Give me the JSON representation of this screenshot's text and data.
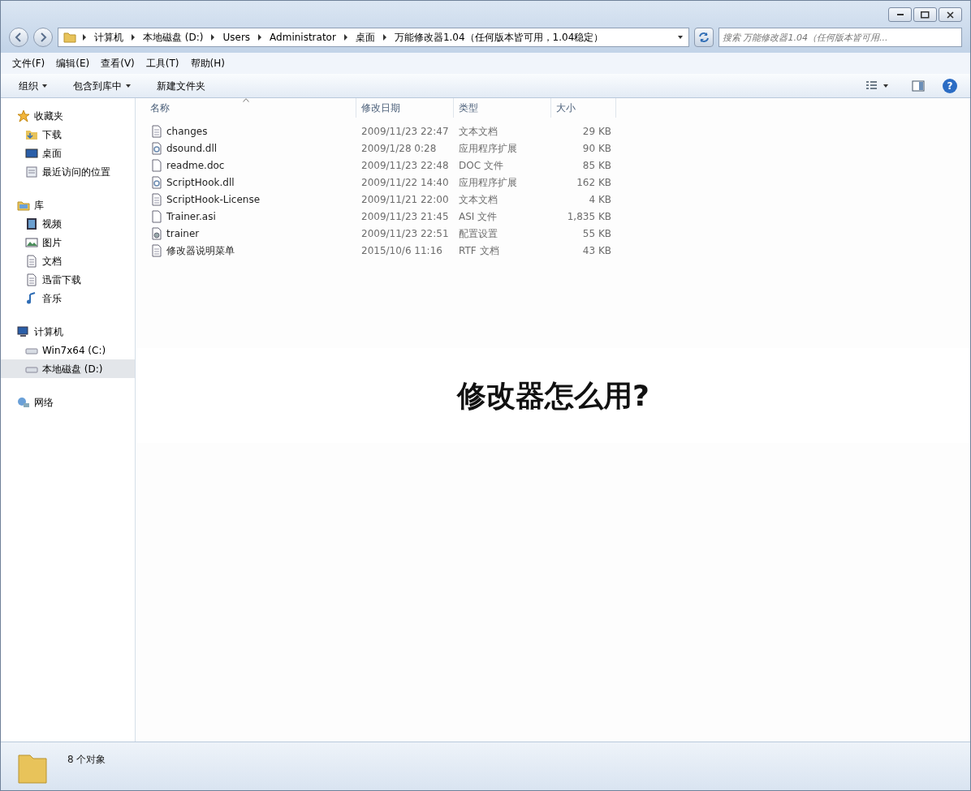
{
  "window": {
    "buttons": [
      {
        "kind": "minimize"
      },
      {
        "kind": "maximize"
      },
      {
        "kind": "close"
      }
    ]
  },
  "address_bar": {
    "crumbs": [
      "计算机",
      "本地磁盘 (D:)",
      "Users",
      "Administrator",
      "桌面",
      "万能修改器1.04（任何版本皆可用，1.04稳定）"
    ]
  },
  "search": {
    "placeholder": "搜索 万能修改器1.04（任何版本皆可用..."
  },
  "menu": [
    "文件(F)",
    "编辑(E)",
    "查看(V)",
    "工具(T)",
    "帮助(H)"
  ],
  "toolbar": [
    {
      "label": "组织",
      "dropdown": true
    },
    {
      "label": "包含到库中",
      "dropdown": true
    },
    {
      "label": "新建文件夹",
      "dropdown": false
    }
  ],
  "sidebar": {
    "groups": [
      {
        "label": "收藏夹",
        "kind": "star",
        "selected": false,
        "children": [
          {
            "label": "下载",
            "kind": "download",
            "selected": false
          },
          {
            "label": "桌面",
            "kind": "desktop",
            "selected": false
          },
          {
            "label": "最近访问的位置",
            "kind": "recent",
            "selected": false
          }
        ]
      },
      {
        "label": "库",
        "kind": "library",
        "selected": false,
        "children": [
          {
            "label": "视频",
            "kind": "video",
            "selected": false
          },
          {
            "label": "图片",
            "kind": "picture",
            "selected": false
          },
          {
            "label": "文档",
            "kind": "document",
            "selected": false
          },
          {
            "label": "迅雷下载",
            "kind": "document",
            "selected": false
          },
          {
            "label": "音乐",
            "kind": "music",
            "selected": false
          }
        ]
      },
      {
        "label": "计算机",
        "kind": "computer",
        "selected": false,
        "children": [
          {
            "label": "Win7x64 (C:)",
            "kind": "drive",
            "selected": false
          },
          {
            "label": "本地磁盘 (D:)",
            "kind": "drive",
            "selected": true
          }
        ]
      },
      {
        "label": "网络",
        "kind": "network",
        "selected": false
      }
    ]
  },
  "table": {
    "columns": [
      {
        "label": "名称",
        "sorted": true
      },
      {
        "label": "修改日期",
        "sorted": false
      },
      {
        "label": "类型",
        "sorted": false
      },
      {
        "label": "大小",
        "sorted": false
      }
    ],
    "rows": [
      {
        "kind": "text",
        "name": "changes",
        "date": "2009/11/23 22:47",
        "type": "文本文档",
        "size": "29 KB"
      },
      {
        "kind": "dll",
        "name": "dsound.dll",
        "date": "2009/1/28 0:28",
        "type": "应用程序扩展",
        "size": "90 KB"
      },
      {
        "kind": "blank",
        "name": "readme.doc",
        "date": "2009/11/23 22:48",
        "type": "DOC 文件",
        "size": "85 KB"
      },
      {
        "kind": "dll",
        "name": "ScriptHook.dll",
        "date": "2009/11/22 14:40",
        "type": "应用程序扩展",
        "size": "162 KB"
      },
      {
        "kind": "text",
        "name": "ScriptHook-License",
        "date": "2009/11/21 22:00",
        "type": "文本文档",
        "size": "4 KB"
      },
      {
        "kind": "blank",
        "name": "Trainer.asi",
        "date": "2009/11/23 21:45",
        "type": "ASI 文件",
        "size": "1,835 KB"
      },
      {
        "kind": "config",
        "name": "trainer",
        "date": "2009/11/23 22:51",
        "type": "配置设置",
        "size": "55 KB"
      },
      {
        "kind": "text",
        "name": "修改器说明菜单",
        "date": "2015/10/6 11:16",
        "type": "RTF 文档",
        "size": "43 KB"
      }
    ]
  },
  "help_button": {
    "label": "?"
  },
  "status_bar": {
    "count": "8 个对象"
  },
  "overlay_caption": "修改器怎么用?"
}
